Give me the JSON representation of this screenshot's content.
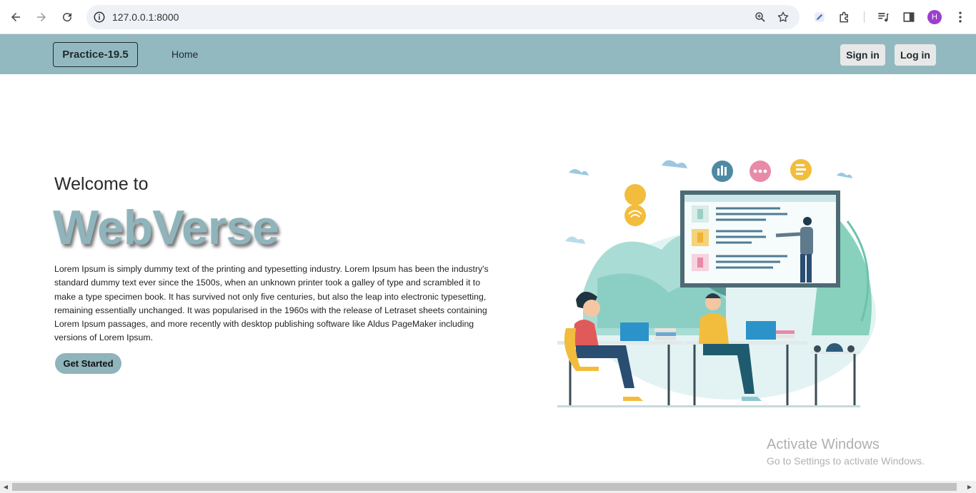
{
  "browser": {
    "url": "127.0.0.1:8000",
    "avatar_letter": "H",
    "icons": [
      "back-icon",
      "forward-icon",
      "reload-icon",
      "site-info-icon",
      "zoom-icon",
      "bookmark-star-icon",
      "extension-pen-icon",
      "extensions-puzzle-icon",
      "media-control-icon",
      "side-panel-icon",
      "menu-kebab-icon"
    ]
  },
  "navbar": {
    "brand": "Practice-19.5",
    "home": "Home",
    "signin": "Sign in",
    "login": "Log in",
    "background": "#93b9c0"
  },
  "hero": {
    "welcome": "Welcome to",
    "title": "WebVerse",
    "body": "Lorem Ipsum is simply dummy text of the printing and typesetting industry. Lorem Ipsum has been the industry's standard dummy text ever since the 1500s, when an unknown printer took a galley of type and scrambled it to make a type specimen book. It has survived not only five centuries, but also the leap into electronic typesetting, remaining essentially unchanged. It was popularised in the 1960s with the release of Letraset sheets containing Lorem Ipsum passages, and more recently with desktop publishing software like Aldus PageMaker including versions of Lorem Ipsum.",
    "cta": "Get Started",
    "accent": "#8fb4bb"
  },
  "watermark": {
    "line1": "Activate Windows",
    "line2": "Go to Settings to activate Windows."
  }
}
